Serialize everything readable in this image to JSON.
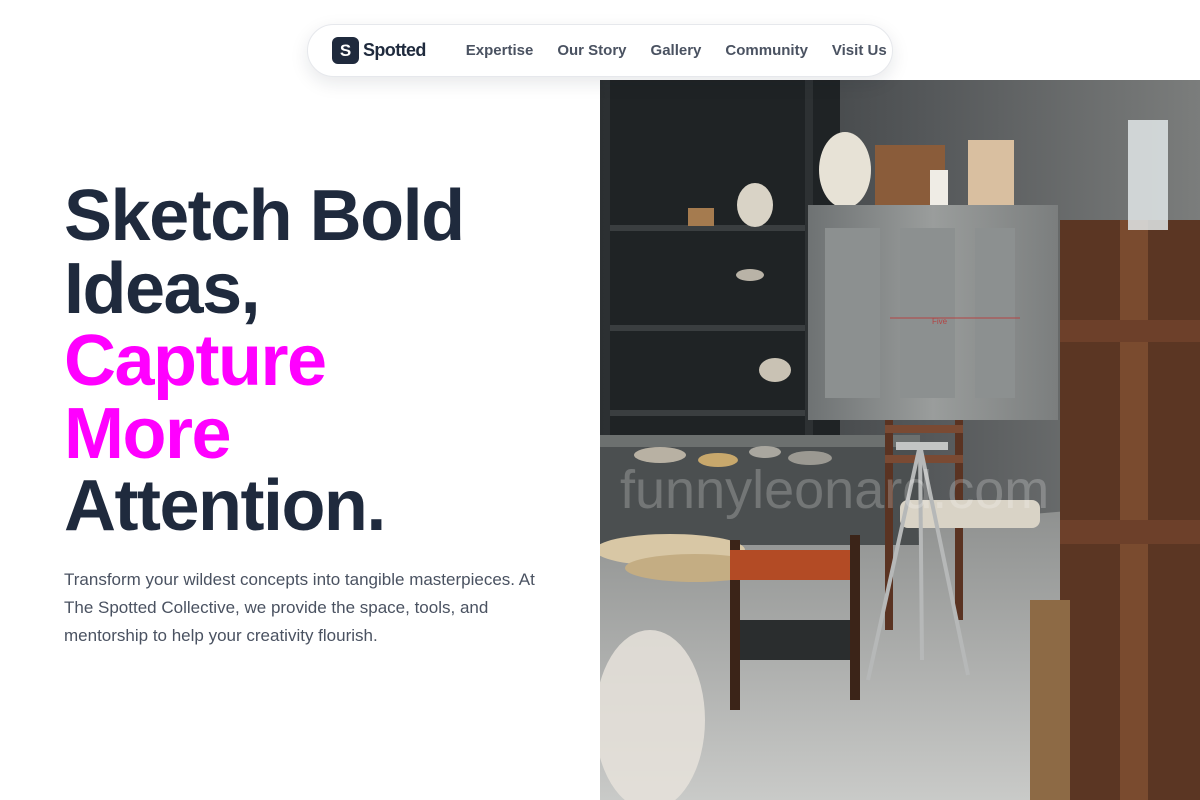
{
  "nav": {
    "logo_letter": "S",
    "logo_text": "Spotted",
    "links": [
      {
        "label": "Expertise"
      },
      {
        "label": "Our Story"
      },
      {
        "label": "Gallery"
      },
      {
        "label": "Community"
      },
      {
        "label": "Visit Us"
      }
    ]
  },
  "hero": {
    "headline": {
      "line1": "Sketch Bold",
      "line2": "Ideas,",
      "line3": "Capture",
      "line4": "More",
      "line5": "Attention."
    },
    "intro": "Transform your wildest concepts into tangible masterpieces. At The Spotted Collective, we provide the space, tools, and mentorship to help your creativity flourish.",
    "image": {
      "watermark": "funnyleonard.com",
      "kiln_label": "Five"
    }
  },
  "colors": {
    "ink": "#1f2a3d",
    "accent": "#ff00ff",
    "body_text": "#4a5261"
  }
}
